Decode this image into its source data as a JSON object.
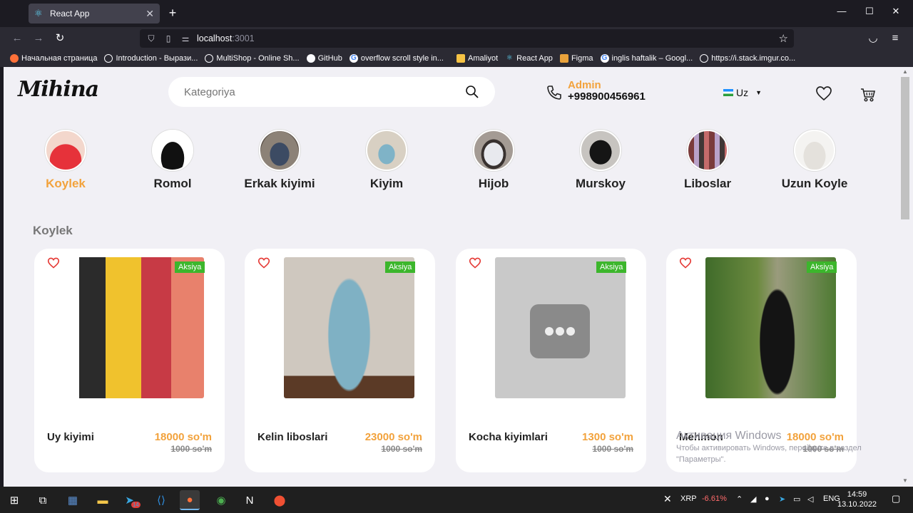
{
  "browser": {
    "tab_title": "React App",
    "url_host": "localhost",
    "url_port": ":3001",
    "bookmarks": [
      "Начальная страница",
      "Introduction - Вырази...",
      "MultiShop - Online Sh...",
      "GitHub",
      "overflow scroll style in...",
      "Amaliyot",
      "React App",
      "Figma",
      "inglis haftalik – Googl...",
      "https://i.stack.imgur.co..."
    ]
  },
  "header": {
    "logo": "Mihina",
    "search_placeholder": "Kategoriya",
    "contact_role": "Admin",
    "contact_phone": "+998900456961",
    "language": "Uz"
  },
  "categories": [
    {
      "label": "Koylek",
      "active": true
    },
    {
      "label": "Romol",
      "active": false
    },
    {
      "label": "Erkak kiyimi",
      "active": false
    },
    {
      "label": "Kiyim",
      "active": false
    },
    {
      "label": "Hijob",
      "active": false
    },
    {
      "label": "Murskoy",
      "active": false
    },
    {
      "label": "Liboslar",
      "active": false
    },
    {
      "label": "Uzun Koyle",
      "active": false
    }
  ],
  "section": {
    "title": "Koylek"
  },
  "products": [
    {
      "name": "Uy kiyimi",
      "price": "18000 so'm",
      "old_price": "1000 so'm",
      "badge": "Aksiya"
    },
    {
      "name": "Kelin liboslari",
      "price": "23000 so'm",
      "old_price": "1000 so'm",
      "badge": "Aksiya"
    },
    {
      "name": "Kocha kiyimlari",
      "price": "1300 so'm",
      "old_price": "1000 so'm",
      "badge": "Aksiya"
    },
    {
      "name": "Mehmon",
      "price": "18000 so'm",
      "old_price": "1000 so'm",
      "badge": "Aksiya"
    }
  ],
  "watermark": {
    "title": "Активация Windows",
    "line1": "Чтобы активировать Windows, перейдите в раздел",
    "line2": "\"Параметры\"."
  },
  "taskbar": {
    "ticker": "XRP",
    "ticker_change": "-6.61%",
    "lang": "ENG",
    "time": "14:59",
    "date": "13.10.2022",
    "badge_count": "14"
  },
  "colors": {
    "accent": "#f2a23c",
    "badge": "#3cb62c",
    "heart": "#e53935"
  }
}
